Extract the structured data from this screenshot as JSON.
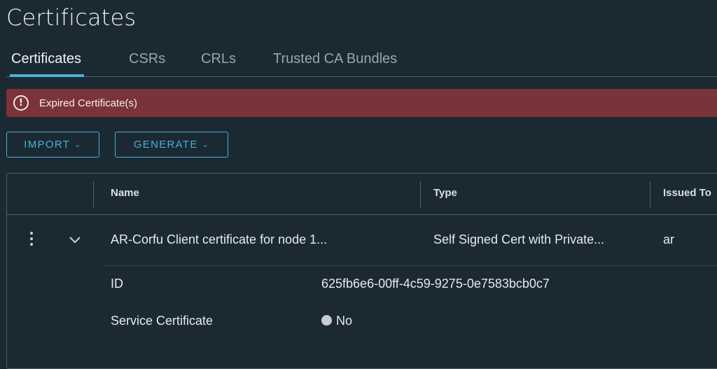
{
  "page": {
    "title": "Certificates"
  },
  "tabs": [
    {
      "label": "Certificates",
      "active": true
    },
    {
      "label": "CSRs",
      "active": false
    },
    {
      "label": "CRLs",
      "active": false
    },
    {
      "label": "Trusted CA Bundles",
      "active": false
    }
  ],
  "alert": {
    "message": "Expired Certificate(s)",
    "icon": "exclamation-circle-icon",
    "color": "#7a3338"
  },
  "actions": {
    "import_label": "IMPORT",
    "generate_label": "GENERATE",
    "accent": "#49afd9"
  },
  "table": {
    "columns": [
      "Name",
      "Type",
      "Issued To"
    ],
    "rows": [
      {
        "name": "AR-Corfu Client certificate for node 1...",
        "type": "Self Signed Cert with Private...",
        "issued_to": "ar",
        "expanded": true,
        "details": {
          "id_label": "ID",
          "id_value": "625fb6e6-00ff-4c59-9275-0e7583bcb0c7",
          "service_label": "Service Certificate",
          "service_value": "No"
        }
      }
    ]
  }
}
